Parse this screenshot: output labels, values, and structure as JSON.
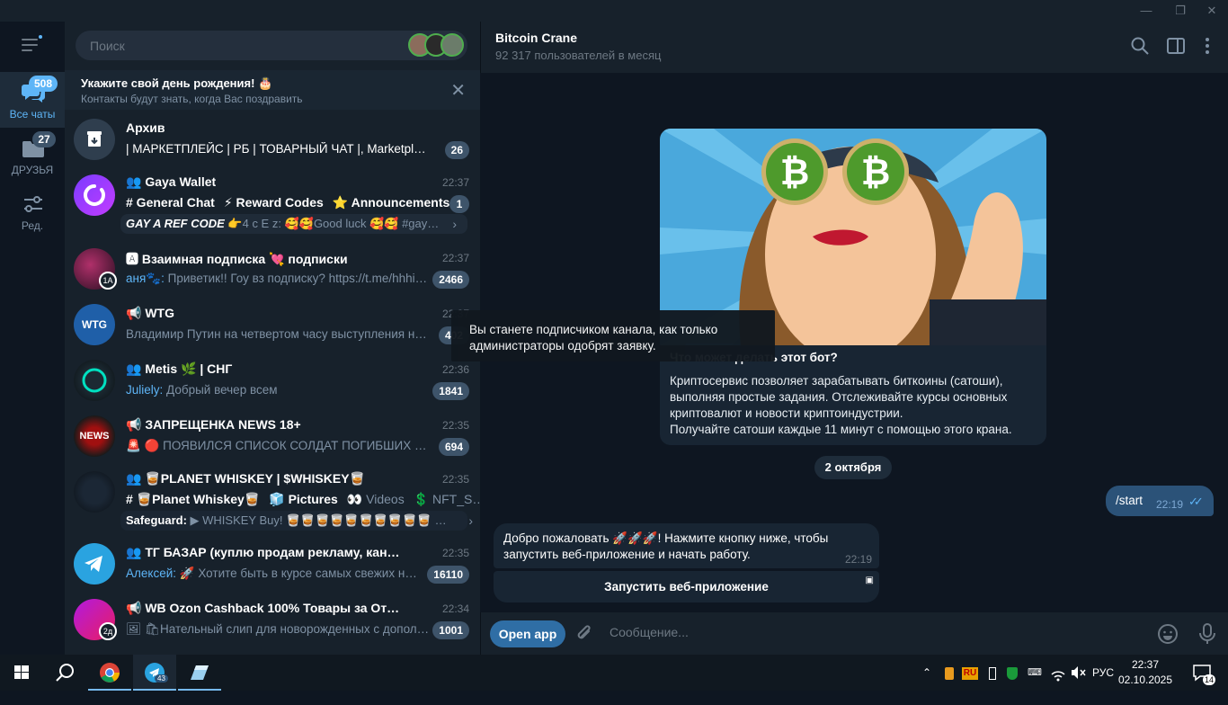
{
  "window": {
    "minimize": "—",
    "restore": "❐",
    "close": "✕"
  },
  "folders": [
    {
      "label": "Все чаты",
      "badge": "508",
      "active": true
    },
    {
      "label": "ДРУЗЬЯ",
      "badge": "27",
      "active": false
    },
    {
      "label": "Ред.",
      "badge": "",
      "active": false
    }
  ],
  "search": {
    "placeholder": "Поиск"
  },
  "birthday": {
    "title": "Укажите свой день рождения! 🎂",
    "subtitle": "Контакты будут знать, когда Вас поздравить"
  },
  "chats": [
    {
      "name": "Архив",
      "time": "",
      "preview": "| МАРКЕТПЛЕЙС | РБ | ТОВАРНЫЙ ЧАТ |, Marketplace…",
      "badge": "26"
    },
    {
      "name": "👥 Gaya Wallet",
      "time": "22:37",
      "topics": [
        "# General Chat",
        "⚡ Reward Codes",
        "⭐ Announcements"
      ],
      "preview_bold": "GAY A REF CODE",
      "preview": "👉4 c E z: 🥰🥰Good luck 🥰🥰 #gay…",
      "badge": "1"
    },
    {
      "name": "🅰 Взаимная подписка 💘 подписки",
      "time": "22:37",
      "sender": "аня🐾:",
      "preview": "Приветик!! Гоу вз подписку? https://t.me/hhhi…",
      "badge": "2466"
    },
    {
      "name": "📢 WTG",
      "time": "22:37",
      "preview": "Владимир Путин на четвертом часу выступления на \"…",
      "badge": "402"
    },
    {
      "name": "👥 Metis 🌿 | СНГ",
      "time": "22:36",
      "sender": "Juliely:",
      "preview": "Добрый вечер всем",
      "badge": "1841"
    },
    {
      "name": "📢 ЗАПРЕЩЕНКА NEWS 18+",
      "time": "22:35",
      "preview": "🚨 🔴 ПОЯВИЛСЯ СПИСОК СОЛДАТ ПОГИБШИХ В СПЕ…",
      "badge": "694"
    },
    {
      "name": "👥 🥃PLANET WHISKEY | $WHISKEY🥃",
      "time": "22:35",
      "topics": [
        "# 🥃Planet Whiskey🥃",
        "🧊 Pictures",
        "👀 Videos",
        "💲 NFT_S…"
      ],
      "preview_bold": "Safeguard:",
      "preview": "▶ WHISKEY Buy! 🥃🥃🥃🥃🥃🥃🥃🥃🥃🥃 …",
      "badge": ""
    },
    {
      "name": "👥 ТГ БАЗАР (куплю продам рекламу, канал, ищу в …",
      "time": "22:35",
      "sender": "Алексей:",
      "preview": "🚀 Хотите быть в курсе самых свежих нов…",
      "badge": "16110"
    },
    {
      "name": "📢 WB Ozon Cashback 100% Товары за Отзыв Выкуп…",
      "time": "22:34",
      "preview": "🖼 🛍Нательный слип для новорожденных с допол…",
      "badge": "1001"
    }
  ],
  "chat": {
    "title": "Bitcoin Crane",
    "subtitle": "92 317 пользователей в месяц",
    "bot_card_title": "Что может делать этот бот?",
    "bot_card_desc": "Криптосервис позволяет зарабатывать биткоины (сатоши),\nвыполняя простые задания. Отслеживайте курсы основных\nкриптовалют и новости криптоиндустрии.\nПолучайте сатоши каждые 11 минут с помощью этого крана.",
    "tooltip": "Вы станете подписчиком канала, как только\nадминистраторы одобрят заявку.",
    "date": "2 октября",
    "out_msg": {
      "text": "/start",
      "time": "22:19"
    },
    "in_msg": {
      "text": "Добро пожаловать 🚀🚀🚀! Нажмите кнопку ниже, чтобы запустить веб-приложение и начать работу.",
      "time": "22:19"
    },
    "kb_button": "Запустить веб-приложение",
    "open_app": "Open app",
    "compose_placeholder": "Сообщение..."
  },
  "taskbar": {
    "telegram_badge": "43",
    "lang_badge": "RU",
    "lang": "РУС",
    "time": "22:37",
    "date": "02.10.2025",
    "notifications": "14"
  },
  "colors": {
    "accent": "#5eb5f7",
    "badge": "#3e546a",
    "out_bubble": "#2b5278",
    "bg": "#0e1621"
  }
}
